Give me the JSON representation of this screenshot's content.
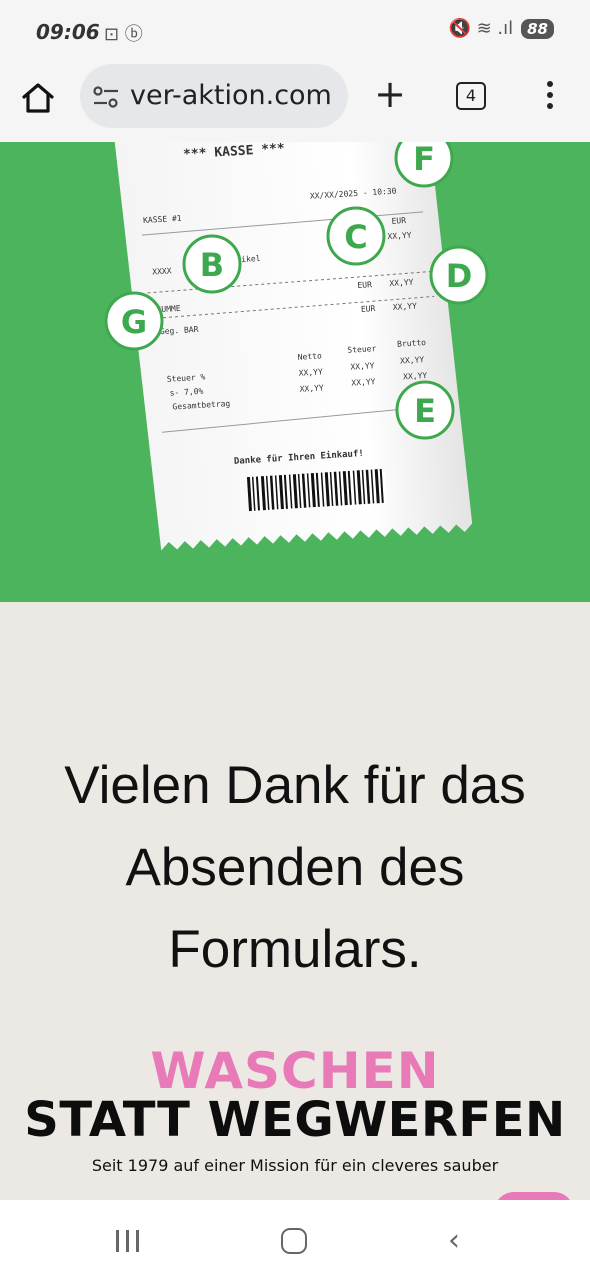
{
  "status_bar": {
    "time": "09:06",
    "left_icons": "⊡ ⓑ",
    "right_icons": "🔇 ≋ .ıl",
    "battery": "88"
  },
  "browser": {
    "url": "ver-aktion.com",
    "new_tab": "+",
    "tab_count": "4"
  },
  "receipt": {
    "header": "*** KASSE ***",
    "register": "KASSE #1",
    "date": "XX/XX/2025 - 10:30",
    "currency": "EUR",
    "item_amount": "XX,YY",
    "item_line": "XXXX",
    "item_suffix": "rtikel",
    "sum_label": "SUMME",
    "sum_currency": "EUR",
    "sum_amount": "XX,YY",
    "paid_label": "Geg. BAR",
    "paid_currency": "EUR",
    "paid_amount": "XX,YY",
    "col_netto": "Netto",
    "col_steuer": "Steuer",
    "col_brutto": "Brutto",
    "tax_label": "Steuer %",
    "tax_rate": "s- 7,0%",
    "total_label": "Gesamtbetrag",
    "cell": "XX,YY",
    "thanks": "Danke für Ihren Einkauf!",
    "markers": [
      "F",
      "C",
      "B",
      "D",
      "G",
      "E"
    ]
  },
  "thanks_message": {
    "line1": "Vielen Dank für das",
    "line2": "Absenden des",
    "line3": "Formulars."
  },
  "brand": {
    "line1": "WASCHEN",
    "line2": "STATT WEGWERFEN",
    "tagline": "Seit 1979 auf einer Mission für ein cleveres sauber"
  },
  "colors": {
    "hero_green": "#4db45e",
    "marker_green": "#3ea84e",
    "brand_pink": "#e97ab8",
    "page_bg": "#ece8e4"
  },
  "icons": {
    "home": "home-icon",
    "site_settings": "tune-icon",
    "menu": "more-vert-icon",
    "nav_recent": "recent-apps-icon",
    "nav_home": "home-pill-icon",
    "nav_back": "back-chevron-icon"
  }
}
